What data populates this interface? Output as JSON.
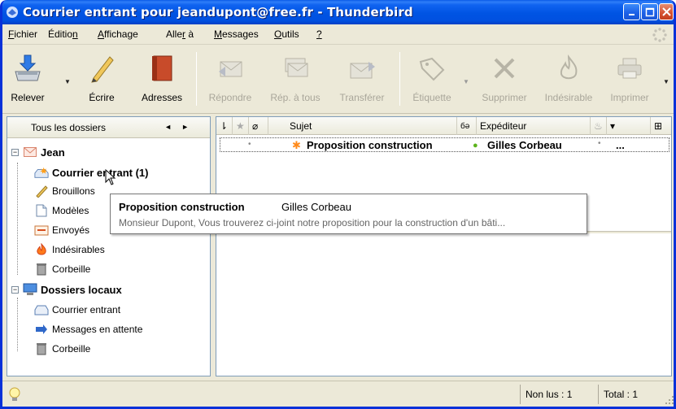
{
  "window": {
    "title": "Courrier entrant pour jeandupont@free.fr - Thunderbird"
  },
  "menu": [
    {
      "label": "Fichier",
      "accel": "F",
      "rest": "ichier"
    },
    {
      "label": "Édition",
      "pre": "Éditio",
      "accel": "n",
      "rest": ""
    },
    {
      "label": "Affichage",
      "accel": "A",
      "rest": "ffichage"
    },
    {
      "label": "Aller à",
      "pre": "Alle",
      "accel": "r",
      "rest": " à"
    },
    {
      "label": "Messages",
      "accel": "M",
      "rest": "essages"
    },
    {
      "label": "Outils",
      "accel": "O",
      "rest": "utils"
    },
    {
      "label": "?",
      "accel": "?",
      "rest": ""
    }
  ],
  "toolbar": {
    "relever": "Relever",
    "ecrire": "Écrire",
    "adresses": "Adresses",
    "repondre": "Répondre",
    "rep_a_tous": "Rép. à tous",
    "transferer": "Transférer",
    "etiquette": "Étiquette",
    "supprimer": "Supprimer",
    "indesirable": "Indésirable",
    "imprimer": "Imprimer"
  },
  "folder_pane": {
    "header": "Tous les dossiers",
    "account1": "Jean",
    "inbox": "Courrier entrant (1)",
    "drafts": "Brouillons",
    "templates": "Modèles",
    "sent": "Envoyés",
    "junk": "Indésirables",
    "trash": "Corbeille",
    "account2": "Dossiers locaux",
    "local_inbox": "Courrier entrant",
    "outbox": "Messages en attente",
    "local_trash": "Corbeille"
  },
  "message_list": {
    "columns": {
      "subject": "Sujet",
      "sender": "Expéditeur"
    },
    "rows": [
      {
        "subject": "Proposition construction",
        "sender": "Gilles Corbeau",
        "date": "..."
      }
    ]
  },
  "tooltip": {
    "subject": "Proposition construction",
    "sender": "Gilles Corbeau",
    "preview": "Monsieur Dupont, Vous trouverez ci-joint notre proposition pour la construction d'un bâti..."
  },
  "status": {
    "unread": "Non lus : 1",
    "total": "Total : 1"
  },
  "colors": {
    "titlebar": "#0054e3",
    "chrome": "#ece9d8",
    "border": "#7f9db9"
  }
}
